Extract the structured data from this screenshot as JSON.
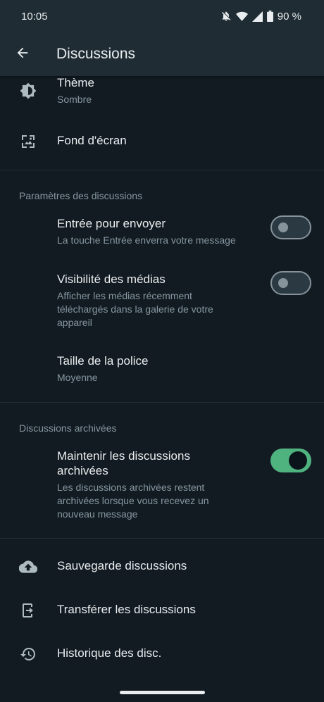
{
  "status": {
    "time": "10:05",
    "battery": "90 %"
  },
  "appbar": {
    "title": "Discussions"
  },
  "display": {
    "theme": {
      "title": "Thème",
      "value": "Sombre"
    },
    "wallpaper": {
      "title": "Fond d'écran"
    }
  },
  "chat_settings": {
    "label": "Paramètres des discussions",
    "enter_send": {
      "title": "Entrée pour envoyer",
      "sub": "La touche Entrée enverra votre message",
      "on": false
    },
    "media_visibility": {
      "title": "Visibilité des médias",
      "sub1": "Afficher les médias récemment",
      "sub2": "téléchargés dans la galerie de votre",
      "sub3": "appareil",
      "on": false
    },
    "font_size": {
      "title": "Taille de la police",
      "value": "Moyenne"
    }
  },
  "archived": {
    "label": "Discussions archivées",
    "keep": {
      "title1": "Maintenir les discussions",
      "title2": "archivées",
      "sub1": "Les discussions archivées restent",
      "sub2": "archivées lorsque vous recevez un",
      "sub3": "nouveau message",
      "on": true
    }
  },
  "more": {
    "backup": "Sauvegarde discussions",
    "transfer": "Transférer les discussions",
    "history": "Historique des disc."
  },
  "colors": {
    "accent": "#4fb37f",
    "background": "#121b22",
    "bar": "#1f2c34",
    "secondary_text": "#8696a0"
  }
}
